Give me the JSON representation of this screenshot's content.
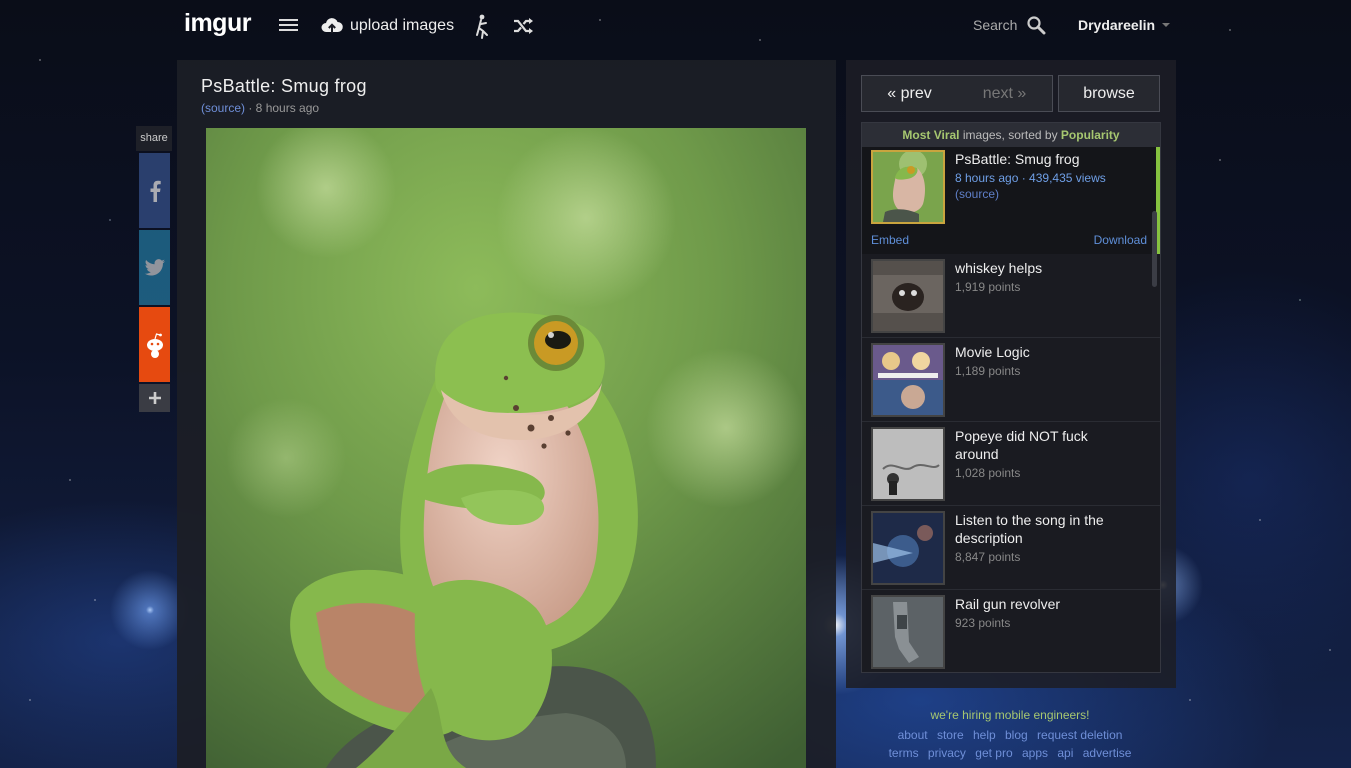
{
  "header": {
    "logo": "imgur",
    "upload_label": "upload images",
    "search_label": "Search",
    "username": "Drydareelin"
  },
  "share": {
    "label": "share"
  },
  "post": {
    "title": "PsBattle: Smug frog",
    "source_label": "(source)",
    "time_text": " · 8 hours ago"
  },
  "sidebar": {
    "prev_label": "« prev",
    "next_label": "next »",
    "browse_label": "browse",
    "heading_viral": "Most Viral",
    "heading_mid": " images, sorted by ",
    "heading_sort": "Popularity",
    "current": {
      "title": "PsBattle: Smug frog",
      "meta": "8 hours ago · 439,435 views",
      "source": "(source)",
      "embed_label": "Embed",
      "download_label": "Download"
    },
    "items": [
      {
        "title": "whiskey helps",
        "points": "1,919 points"
      },
      {
        "title": "Movie Logic",
        "points": "1,189 points"
      },
      {
        "title": "Popeye did NOT fuck around",
        "points": "1,028 points"
      },
      {
        "title": "Listen to the song in the description",
        "points": "8,847 points"
      },
      {
        "title": "Rail gun revolver",
        "points": "923 points"
      }
    ]
  },
  "footer": {
    "hiring": "we're hiring mobile engineers!",
    "links_row1": [
      "about",
      "store",
      "help",
      "blog",
      "request deletion"
    ],
    "links_row2": [
      "terms",
      "privacy",
      "get pro",
      "apps",
      "api",
      "advertise"
    ]
  },
  "colors": {
    "accent_green": "#86c240",
    "link_blue": "#6f8fd8",
    "reddit_orange": "#e64a10"
  }
}
